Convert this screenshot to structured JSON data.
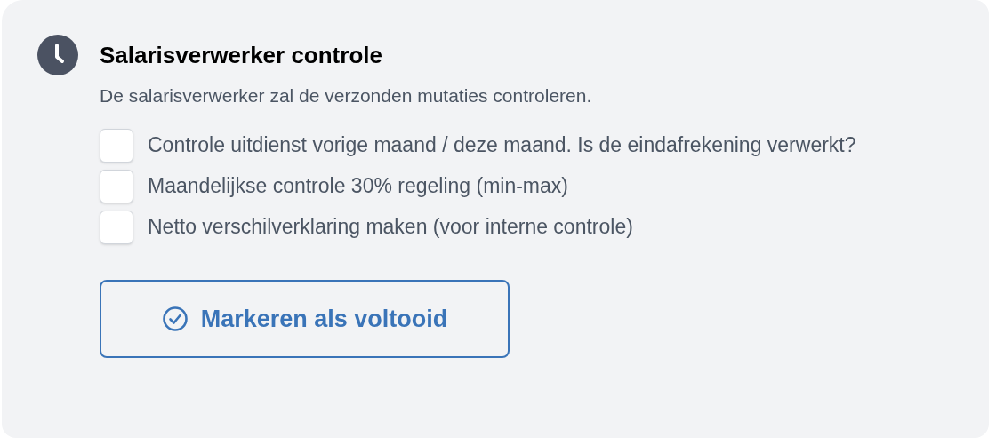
{
  "task": {
    "title": "Salarisverwerker controle",
    "description": "De salarisverwerker zal de verzonden mutaties controleren."
  },
  "checklist": [
    {
      "label": "Controle uitdienst vorige maand / deze maand. Is de eindafrekening verwerkt?",
      "checked": false
    },
    {
      "label": "Maandelijkse controle 30% regeling (min-max)",
      "checked": false
    },
    {
      "label": "Netto verschilverklaring maken (voor interne controle)",
      "checked": false
    }
  ],
  "button": {
    "label": "Markeren als voltooid"
  }
}
